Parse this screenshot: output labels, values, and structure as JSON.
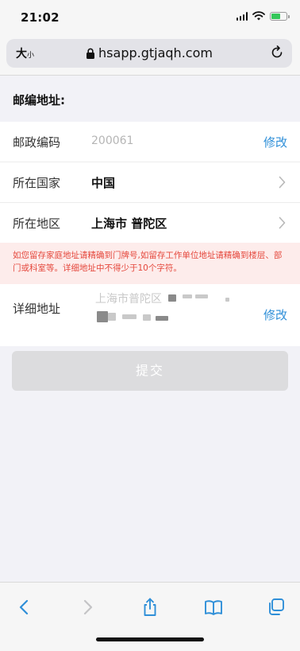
{
  "status_bar": {
    "time": "21:02"
  },
  "browser": {
    "text_size_label": "大",
    "text_size_small": "小",
    "url": "hsapp.gtjaqh.com"
  },
  "form": {
    "section_title": "邮编地址:",
    "postal_code": {
      "label": "邮政编码",
      "value": "200061",
      "action": "修改"
    },
    "country": {
      "label": "所在国家",
      "value": "中国"
    },
    "region": {
      "label": "所在地区",
      "value": "上海市 普陀区"
    },
    "warning": "如您留存家庭地址请精确到门牌号,如留存工作单位地址请精确到楼层、部门或科室等。详细地址中不得少于10个字符。",
    "detail_address": {
      "label": "详细地址",
      "value": "上海市普陀区",
      "action": "修改"
    },
    "submit_label": "提交"
  },
  "colors": {
    "accent": "#2f8fd8",
    "warning_text": "#e5483d",
    "warning_bg": "#fdeceb",
    "submit_disabled": "#dcdcde",
    "battery": "#34c759"
  },
  "icons": [
    "signal-icon",
    "wifi-icon",
    "battery-icon",
    "lock-icon",
    "reload-icon",
    "chevron-right-icon",
    "back-icon",
    "forward-icon",
    "share-icon",
    "bookmarks-icon",
    "tabs-icon"
  ]
}
